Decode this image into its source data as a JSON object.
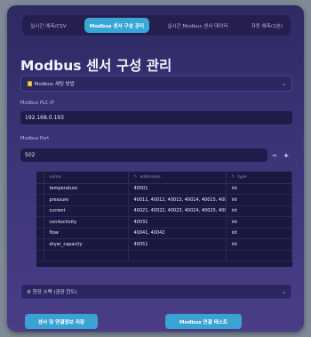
{
  "tabs": [
    {
      "label": "실시간 예측/CSV"
    },
    {
      "label": "Modbus 센서 구성 관리"
    },
    {
      "label": "실시간 Modbus 센서 데이터"
    },
    {
      "label": "자동 예측(1분)"
    }
  ],
  "page_title": "Modbus 센서 구성 관리",
  "settings_expander": {
    "icon": "book-icon",
    "label": "📒 Modbus 세팅 방법"
  },
  "plc_ip": {
    "label": "Modbus PLC IP",
    "value": "192.168.0.193"
  },
  "port": {
    "label": "Modbus Port",
    "value": "502",
    "minus": "−",
    "plus": "+"
  },
  "sensor_table": {
    "columns": [
      {
        "label": "name"
      },
      {
        "icon": "✎",
        "label": "addresses"
      },
      {
        "icon": "✎",
        "label": "type"
      }
    ],
    "rows": [
      {
        "name": "temperature",
        "addresses": "40001",
        "type": "int"
      },
      {
        "name": "pressure",
        "addresses": "40011, 40012, 40013, 40014, 40015, 400",
        "type": "int"
      },
      {
        "name": "current",
        "addresses": "40021, 40022, 40023, 40024, 40025, 400",
        "type": "int"
      },
      {
        "name": "conductivity",
        "addresses": "40031",
        "type": "int"
      },
      {
        "name": "flow",
        "addresses": "40041, 40042",
        "type": "int"
      },
      {
        "name": "dryer_capacity",
        "addresses": "40051",
        "type": "int"
      }
    ]
  },
  "spec_expander": {
    "label": "⚙ 현장 스펙 (권장 한도)"
  },
  "buttons": {
    "save": "센서 및 연결정보 저장",
    "test": "Modbus 연결 테스트"
  },
  "colors": {
    "accent": "#3aa3d3",
    "background": "#3b3578"
  }
}
